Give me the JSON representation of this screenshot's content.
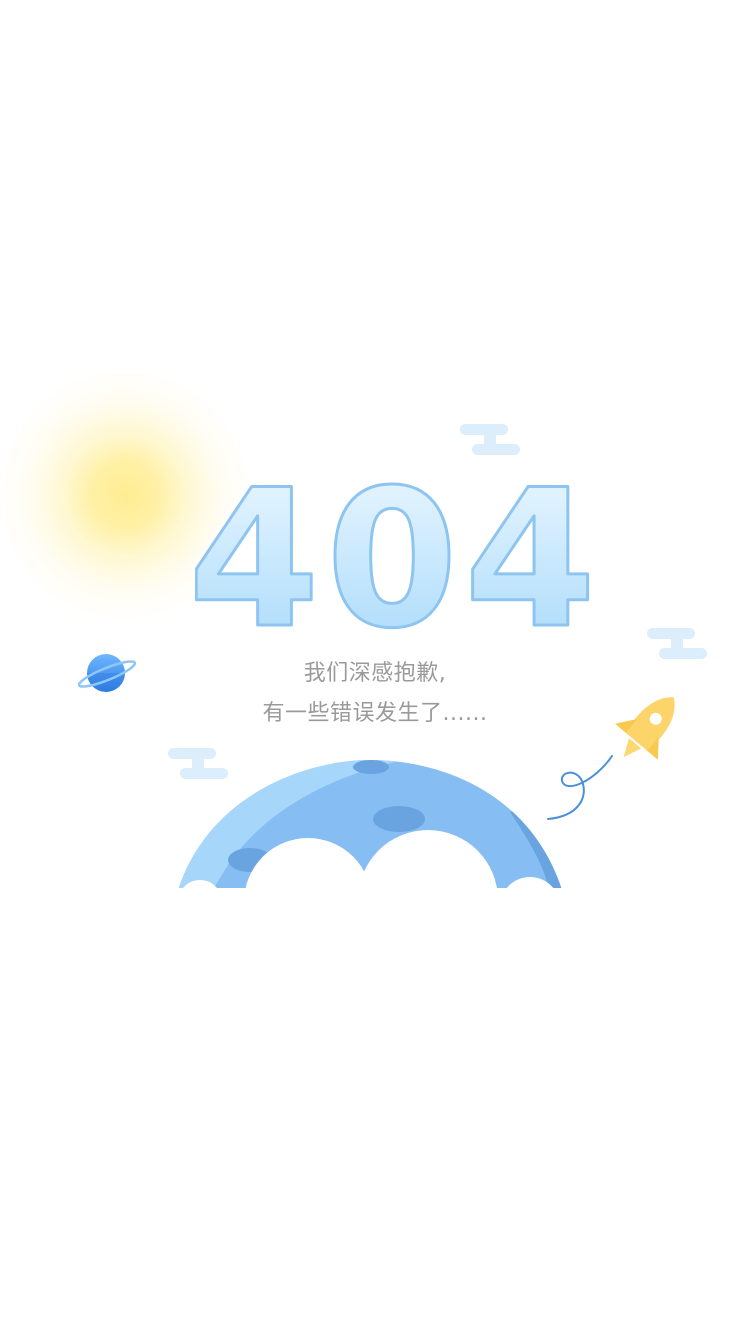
{
  "error": {
    "code": "404",
    "message_line1": "我们深感抱歉,",
    "message_line2": "有一些错误发生了......"
  },
  "icons": {
    "planet": "planet-icon",
    "rocket": "rocket-icon",
    "sun": "sun-glow",
    "moon": "moon-illustration",
    "cloud": "cloud-icon"
  },
  "colors": {
    "digits_fill_top": "#e6f5ff",
    "digits_fill_bottom": "#a9dbfb",
    "digits_outline": "#8ec5f0",
    "message_text": "#9a9a9a",
    "moon_light": "#a7d6fb",
    "moon_mid": "#86bdf2",
    "moon_dark": "#6aa4e0",
    "rocket": "#fcd46a",
    "planet": "#3a8ef0",
    "cloud": "#dcedfb"
  }
}
